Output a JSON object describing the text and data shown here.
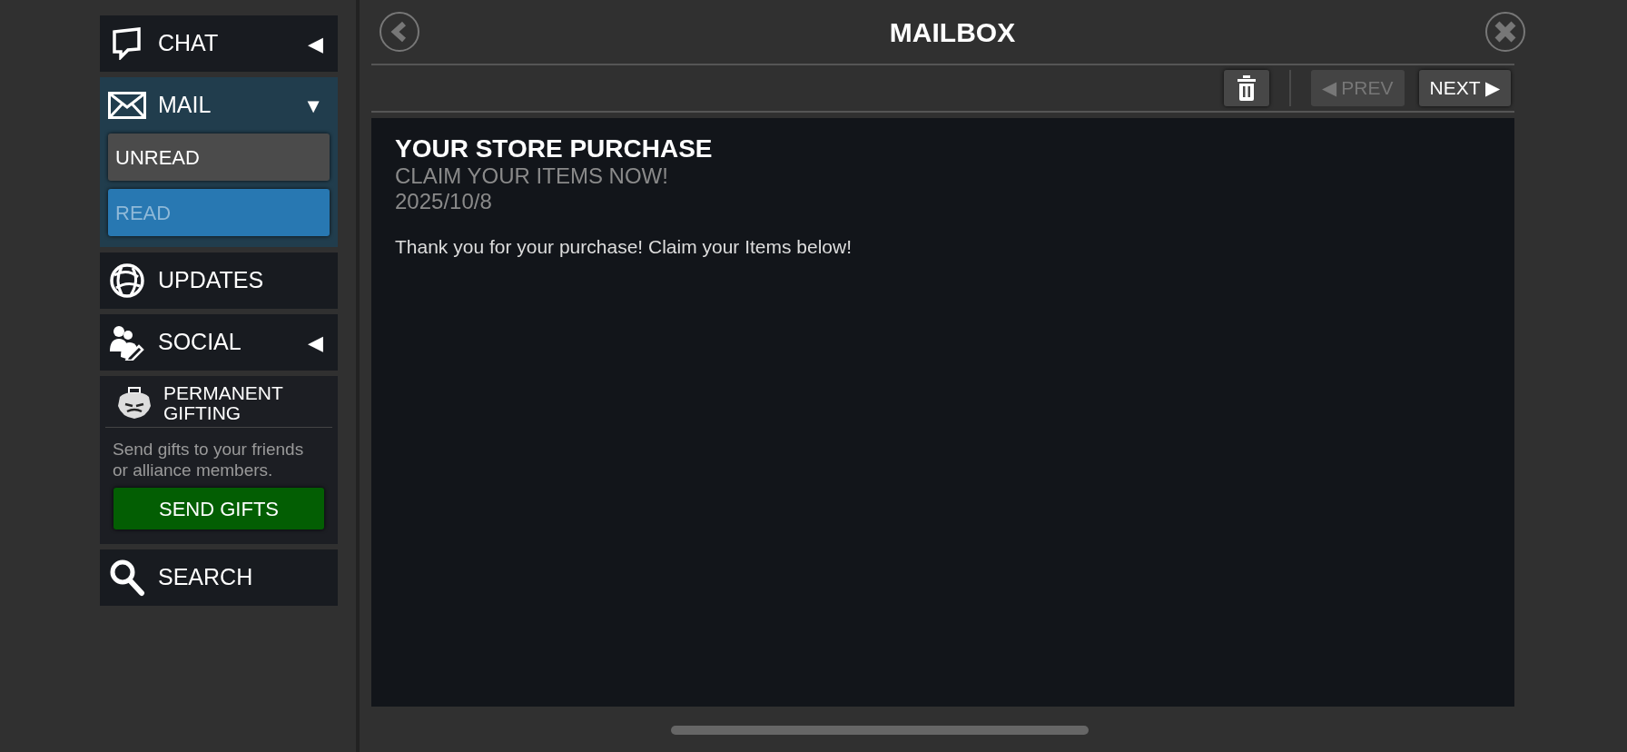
{
  "sidebar": {
    "items": [
      {
        "kind": "nav",
        "label": "CHAT",
        "arrow": "◀",
        "expanded": false
      },
      {
        "kind": "nav",
        "label": "MAIL",
        "arrow": "▼",
        "expanded": true,
        "children": [
          {
            "label": "UNREAD",
            "selected": false
          },
          {
            "label": "READ",
            "selected": true
          }
        ]
      },
      {
        "kind": "nav",
        "label": "UPDATES",
        "expanded": false
      },
      {
        "kind": "nav",
        "label": "SOCIAL",
        "arrow": "◀",
        "expanded": false
      },
      {
        "kind": "promo",
        "title_lines": [
          "PERMANENT",
          "GIFTING"
        ],
        "text": "Send gifts to your friends or alliance members.",
        "button": "SEND GIFTS"
      },
      {
        "kind": "nav",
        "label": "SEARCH",
        "expanded": false
      }
    ]
  },
  "header": {
    "title": "MAILBOX"
  },
  "toolbar": {
    "prev": {
      "label": "PREV",
      "arrow": "◀",
      "disabled": true
    },
    "next": {
      "label": "NEXT",
      "arrow": "▶",
      "disabled": false
    }
  },
  "message": {
    "title": "YOUR STORE PURCHASE",
    "subtitle": "CLAIM YOUR ITEMS NOW!",
    "date": "2025/10/8",
    "body": "Thank you for your purchase! Claim your Items below!"
  }
}
